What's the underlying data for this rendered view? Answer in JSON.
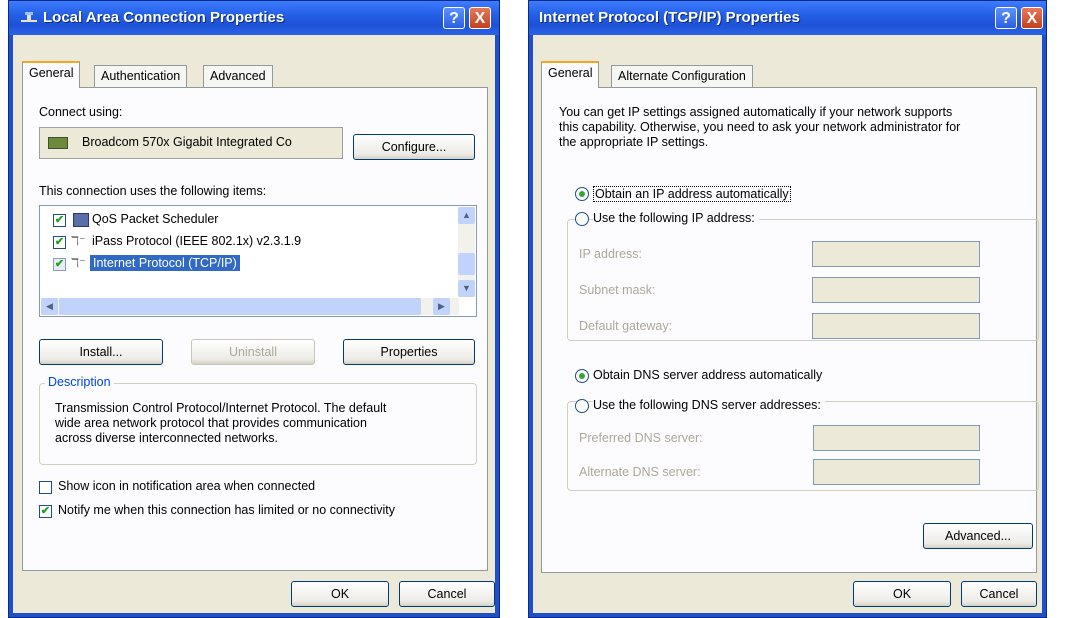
{
  "left": {
    "title": "Local Area Connection Properties",
    "help": "?",
    "close": "X",
    "tabs": [
      "General",
      "Authentication",
      "Advanced"
    ],
    "connect_using": "Connect using:",
    "adapter": "Broadcom 570x Gigabit Integrated Co",
    "configure": "Configure...",
    "items_label": "This connection uses the following items:",
    "items": [
      {
        "label": "QoS Packet Scheduler",
        "checked": true
      },
      {
        "label": "iPass Protocol (IEEE 802.1x) v2.3.1.9",
        "checked": true
      },
      {
        "label": "Internet Protocol (TCP/IP)",
        "checked": true
      }
    ],
    "install": "Install...",
    "uninstall": "Uninstall",
    "properties": "Properties",
    "description_label": "Description",
    "description": [
      "Transmission Control Protocol/Internet Protocol. The default",
      "wide area network protocol that provides communication",
      "across diverse interconnected networks."
    ],
    "show_icon": "Show icon in notification area when connected",
    "notify": "Notify me when this connection has limited or no connectivity",
    "ok": "OK",
    "cancel": "Cancel"
  },
  "right": {
    "title": "Internet Protocol (TCP/IP) Properties",
    "help": "?",
    "close": "X",
    "tabs": [
      "General",
      "Alternate Configuration"
    ],
    "intro": [
      "You can get IP settings assigned automatically if your network supports",
      "this capability. Otherwise, you need to ask your network administrator for",
      "the appropriate IP settings."
    ],
    "obtain_ip": "Obtain an IP address automatically",
    "use_ip": "Use the following IP address:",
    "ip_address": "IP address:",
    "subnet": "Subnet mask:",
    "gateway": "Default gateway:",
    "obtain_dns": "Obtain DNS server address automatically",
    "use_dns": "Use the following DNS server addresses:",
    "preferred_dns": "Preferred DNS server:",
    "alternate_dns": "Alternate DNS server:",
    "advanced": "Advanced...",
    "ok": "OK",
    "cancel": "Cancel"
  },
  "colors": {
    "titlebar": "#2460e6",
    "dialog": "#ece9d8",
    "tab_accent": "#f5a623",
    "selection": "#316ac5"
  }
}
